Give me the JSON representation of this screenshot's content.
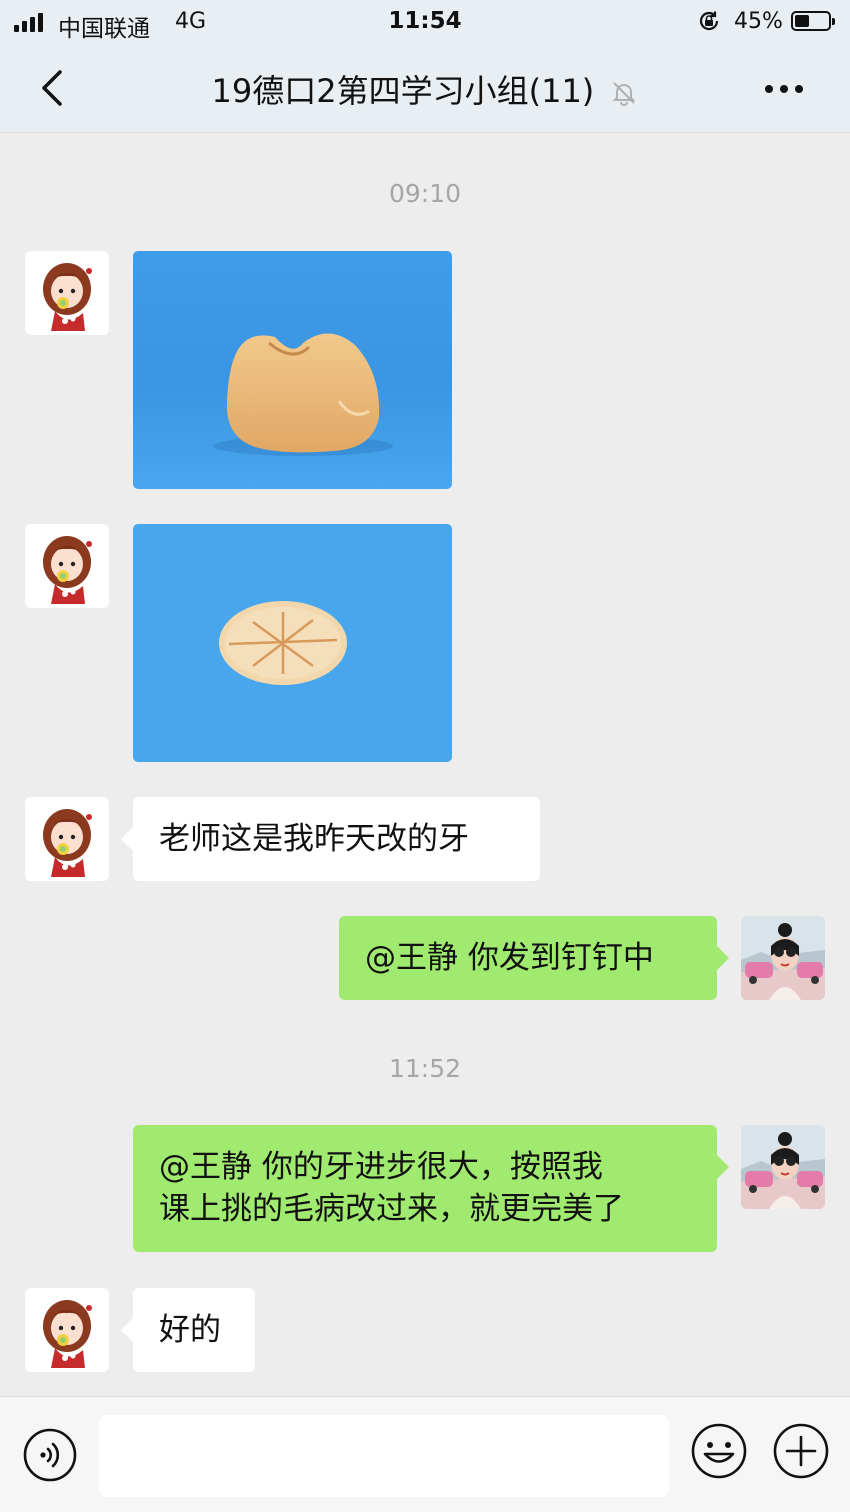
{
  "status_bar": {
    "carrier": "中国联通",
    "network": "4G",
    "time": "11:54",
    "battery": "45%"
  },
  "nav": {
    "title": "19德口2第四学习小组(11)"
  },
  "messages": {
    "time1": "09:10",
    "text1": "老师这是我昨天改的牙",
    "text2": "@王静 你发到钉钉中",
    "time2": "11:52",
    "text3_line1": "@王静 你的牙进步很大，按照我",
    "text3_line2": "课上挑的毛病改过来，就更完美了",
    "text4": "好的"
  },
  "input_bar": {
    "placeholder": ""
  },
  "colors": {
    "sent_bubble": "#a0ea6f",
    "received_bubble": "#ffffff",
    "background": "#ededed",
    "photo_background": "#3d9be6"
  }
}
